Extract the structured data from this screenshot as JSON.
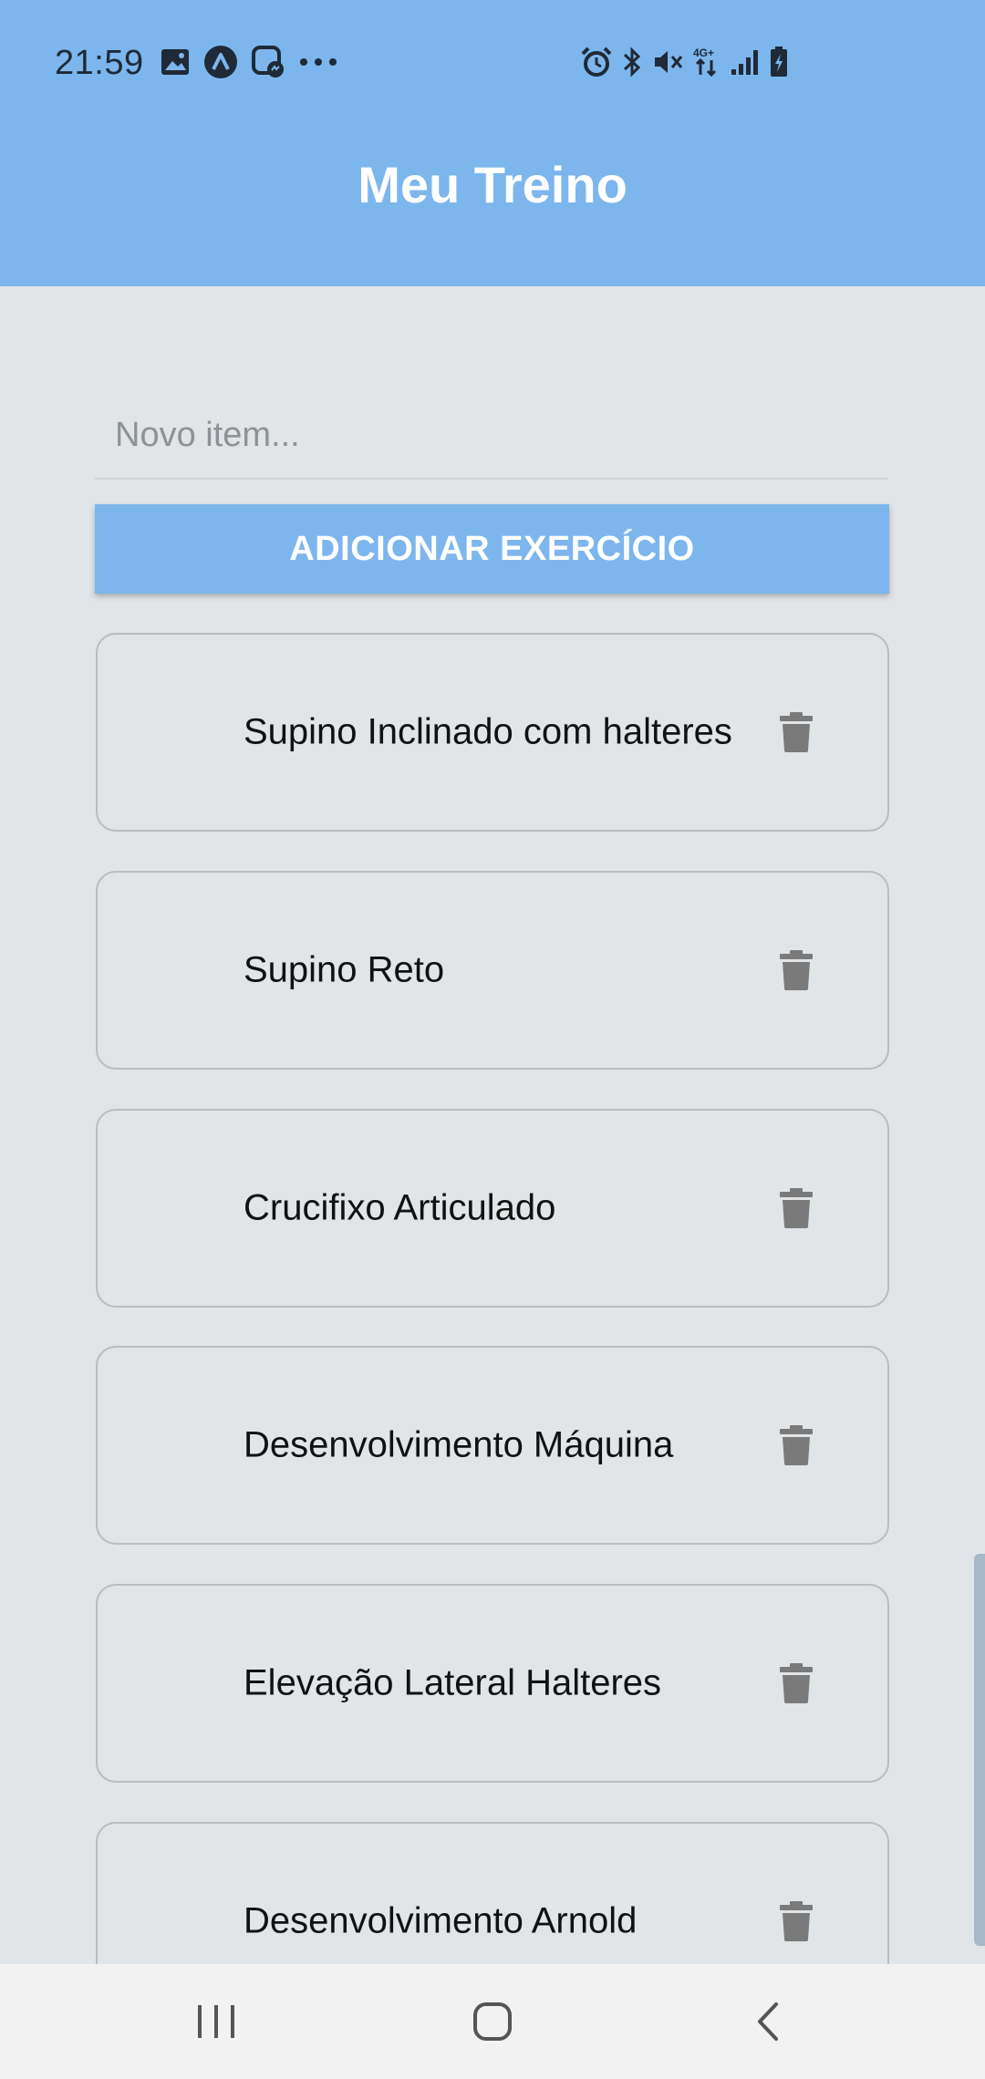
{
  "status_bar": {
    "time": "21:59"
  },
  "header": {
    "title": "Meu Treino"
  },
  "new_item": {
    "placeholder": "Novo item..."
  },
  "add_button": {
    "label": "ADICIONAR EXERCÍCIO"
  },
  "exercises": [
    {
      "name": "Supino Inclinado com halteres"
    },
    {
      "name": "Supino Reto"
    },
    {
      "name": "Crucifixo Articulado"
    },
    {
      "name": "Desenvolvimento Máquina"
    },
    {
      "name": "Elevação Lateral Halteres"
    },
    {
      "name": "Desenvolvimento Arnold"
    }
  ],
  "icons": {
    "delete": "trash-icon",
    "nav_recents": "recents-icon",
    "nav_home": "home-icon",
    "nav_back": "back-icon"
  },
  "colors": {
    "accent": "#7db6ed",
    "background": "#e1e5e7",
    "nav_background": "#f2f2f2",
    "trash": "#7a7a7a"
  }
}
